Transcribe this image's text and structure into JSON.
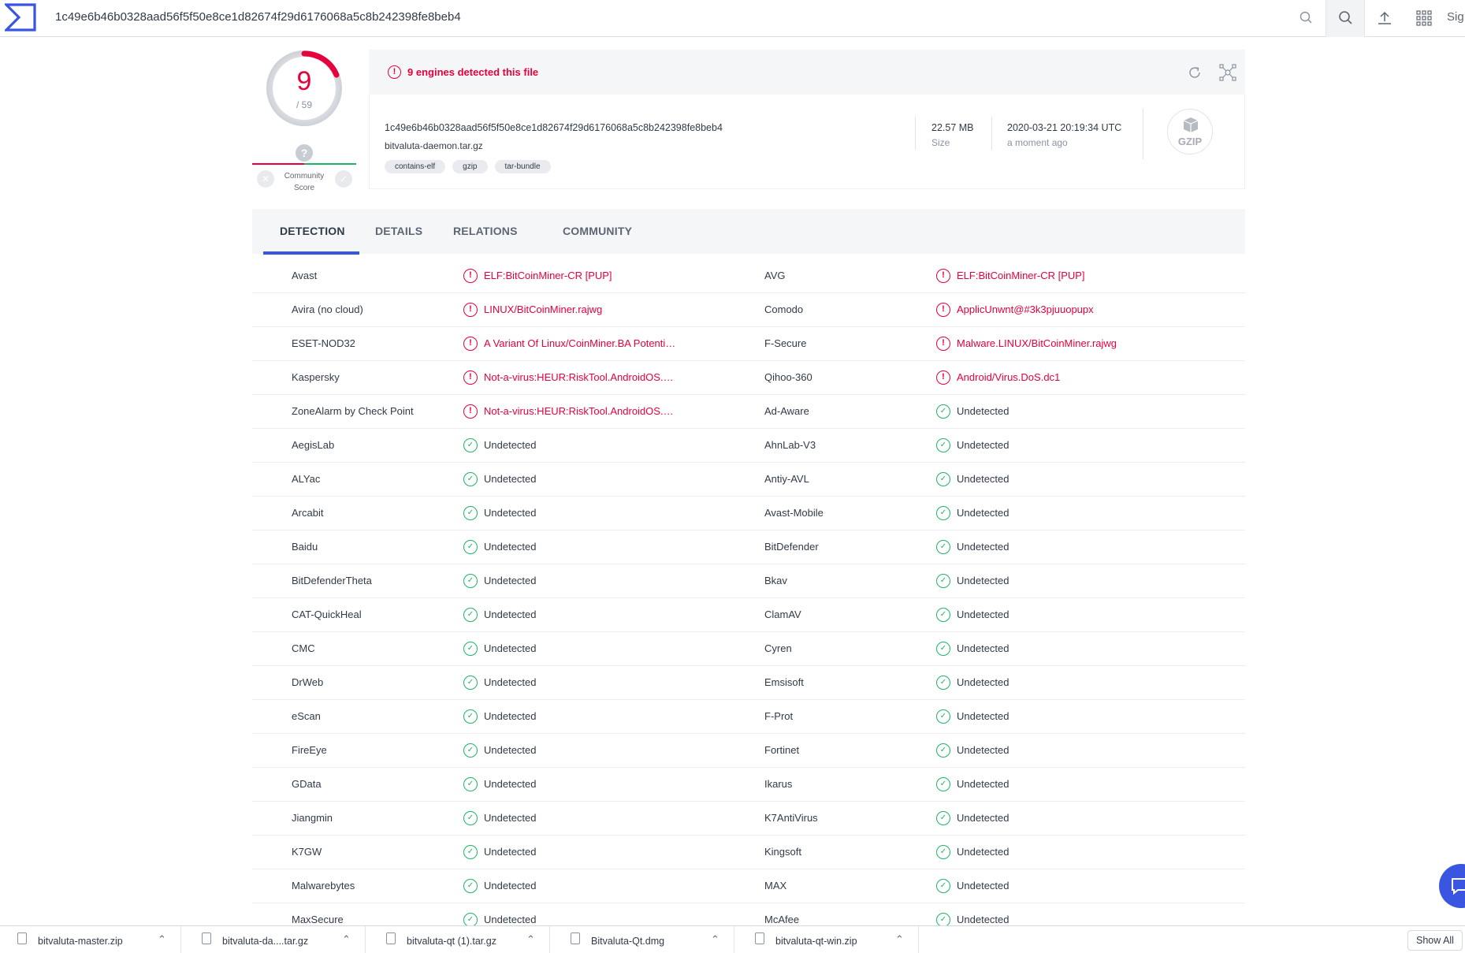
{
  "search": {
    "query": "1c49e6b46b0328aad56f5f50e8ce1d82674f29d6176068a5c8b242398fe8beb4"
  },
  "header": {
    "signin_label": "Sig"
  },
  "score": {
    "detected": "9",
    "total": "/ 59"
  },
  "community": {
    "question": "?",
    "label": "Community Score"
  },
  "file": {
    "alert": "9 engines detected this file",
    "hash": "1c49e6b46b0328aad56f5f50e8ce1d82674f29d6176068a5c8b242398fe8beb4",
    "name": "bitvaluta-daemon.tar.gz",
    "tags": [
      "contains-elf",
      "gzip",
      "tar-bundle"
    ],
    "size_value": "22.57 MB",
    "size_label": "Size",
    "date_value": "2020-03-21 20:19:34 UTC",
    "date_label": "a moment ago",
    "type_badge": "GZIP"
  },
  "tabs": [
    "DETECTION",
    "DETAILS",
    "RELATIONS",
    "COMMUNITY"
  ],
  "active_tab": "DETECTION",
  "colors": {
    "accent": "#3a55e0",
    "malicious": "#e6003c",
    "clean": "#1eb464"
  },
  "detections": [
    [
      {
        "engine": "Avast",
        "result": "ELF:BitCoinMiner-CR [PUP]",
        "status": "bad"
      },
      {
        "engine": "AVG",
        "result": "ELF:BitCoinMiner-CR [PUP]",
        "status": "bad"
      }
    ],
    [
      {
        "engine": "Avira (no cloud)",
        "result": "LINUX/BitCoinMiner.rajwg",
        "status": "bad"
      },
      {
        "engine": "Comodo",
        "result": "ApplicUnwnt@#3k3pjuuopupx",
        "status": "bad"
      }
    ],
    [
      {
        "engine": "ESET-NOD32",
        "result": "A Variant Of Linux/CoinMiner.BA Potenti…",
        "status": "bad"
      },
      {
        "engine": "F-Secure",
        "result": "Malware.LINUX/BitCoinMiner.rajwg",
        "status": "bad"
      }
    ],
    [
      {
        "engine": "Kaspersky",
        "result": "Not-a-virus:HEUR:RiskTool.AndroidOS.…",
        "status": "bad"
      },
      {
        "engine": "Qihoo-360",
        "result": "Android/Virus.DoS.dc1",
        "status": "bad"
      }
    ],
    [
      {
        "engine": "ZoneAlarm by Check Point",
        "result": "Not-a-virus:HEUR:RiskTool.AndroidOS.…",
        "status": "bad"
      },
      {
        "engine": "Ad-Aware",
        "result": "Undetected",
        "status": "good"
      }
    ],
    [
      {
        "engine": "AegisLab",
        "result": "Undetected",
        "status": "good"
      },
      {
        "engine": "AhnLab-V3",
        "result": "Undetected",
        "status": "good"
      }
    ],
    [
      {
        "engine": "ALYac",
        "result": "Undetected",
        "status": "good"
      },
      {
        "engine": "Antiy-AVL",
        "result": "Undetected",
        "status": "good"
      }
    ],
    [
      {
        "engine": "Arcabit",
        "result": "Undetected",
        "status": "good"
      },
      {
        "engine": "Avast-Mobile",
        "result": "Undetected",
        "status": "good"
      }
    ],
    [
      {
        "engine": "Baidu",
        "result": "Undetected",
        "status": "good"
      },
      {
        "engine": "BitDefender",
        "result": "Undetected",
        "status": "good"
      }
    ],
    [
      {
        "engine": "BitDefenderTheta",
        "result": "Undetected",
        "status": "good"
      },
      {
        "engine": "Bkav",
        "result": "Undetected",
        "status": "good"
      }
    ],
    [
      {
        "engine": "CAT-QuickHeal",
        "result": "Undetected",
        "status": "good"
      },
      {
        "engine": "ClamAV",
        "result": "Undetected",
        "status": "good"
      }
    ],
    [
      {
        "engine": "CMC",
        "result": "Undetected",
        "status": "good"
      },
      {
        "engine": "Cyren",
        "result": "Undetected",
        "status": "good"
      }
    ],
    [
      {
        "engine": "DrWeb",
        "result": "Undetected",
        "status": "good"
      },
      {
        "engine": "Emsisoft",
        "result": "Undetected",
        "status": "good"
      }
    ],
    [
      {
        "engine": "eScan",
        "result": "Undetected",
        "status": "good"
      },
      {
        "engine": "F-Prot",
        "result": "Undetected",
        "status": "good"
      }
    ],
    [
      {
        "engine": "FireEye",
        "result": "Undetected",
        "status": "good"
      },
      {
        "engine": "Fortinet",
        "result": "Undetected",
        "status": "good"
      }
    ],
    [
      {
        "engine": "GData",
        "result": "Undetected",
        "status": "good"
      },
      {
        "engine": "Ikarus",
        "result": "Undetected",
        "status": "good"
      }
    ],
    [
      {
        "engine": "Jiangmin",
        "result": "Undetected",
        "status": "good"
      },
      {
        "engine": "K7AntiVirus",
        "result": "Undetected",
        "status": "good"
      }
    ],
    [
      {
        "engine": "K7GW",
        "result": "Undetected",
        "status": "good"
      },
      {
        "engine": "Kingsoft",
        "result": "Undetected",
        "status": "good"
      }
    ],
    [
      {
        "engine": "Malwarebytes",
        "result": "Undetected",
        "status": "good"
      },
      {
        "engine": "MAX",
        "result": "Undetected",
        "status": "good"
      }
    ],
    [
      {
        "engine": "MaxSecure",
        "result": "Undetected",
        "status": "good"
      },
      {
        "engine": "McAfee",
        "result": "Undetected",
        "status": "good"
      }
    ]
  ],
  "downloads": {
    "items": [
      "bitvaluta-master.zip",
      "bitvaluta-da....tar.gz",
      "bitvaluta-qt (1).tar.gz",
      "Bitvaluta-Qt.dmg",
      "bitvaluta-qt-win.zip"
    ],
    "show_all": "Show All"
  }
}
